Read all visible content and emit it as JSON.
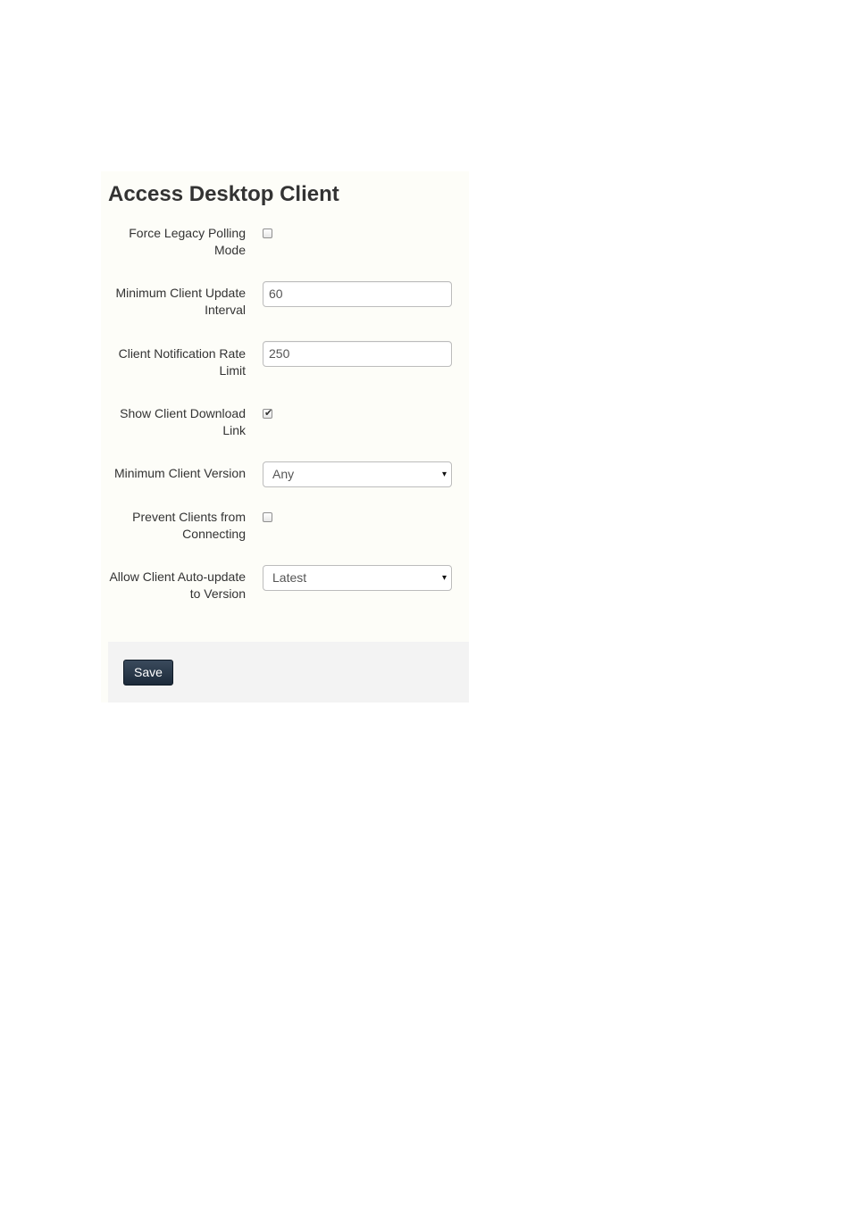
{
  "page": {
    "title": "Access Desktop Client"
  },
  "form": {
    "fields": [
      {
        "label_line1": "Force Legacy Polling",
        "label_line2": "Mode",
        "type": "checkbox",
        "checked": false
      },
      {
        "label_line1": "Minimum Client Update",
        "label_line2": "Interval",
        "type": "text",
        "value": "60"
      },
      {
        "label_line1": "Client Notification Rate",
        "label_line2": "Limit",
        "type": "text",
        "value": "250"
      },
      {
        "label_line1": "Show Client Download",
        "label_line2": "Link",
        "type": "checkbox",
        "checked": true
      },
      {
        "label_line1": "Minimum Client Version",
        "label_line2": "",
        "type": "select",
        "value": "Any"
      },
      {
        "label_line1": "Prevent Clients from",
        "label_line2": "Connecting",
        "type": "checkbox",
        "checked": false
      },
      {
        "label_line1": "Allow Client Auto-update",
        "label_line2": "to Version",
        "type": "select",
        "value": "Latest"
      }
    ],
    "tick_glyph": "✔",
    "select_arrow_glyph": "▾"
  },
  "footer": {
    "save_label": "Save"
  },
  "colors": {
    "panel_background": "#fdfdf8",
    "footer_background": "#f3f3f3",
    "button_background": "#1c2a3a",
    "button_text": "#ffffff",
    "text": "#333333"
  }
}
